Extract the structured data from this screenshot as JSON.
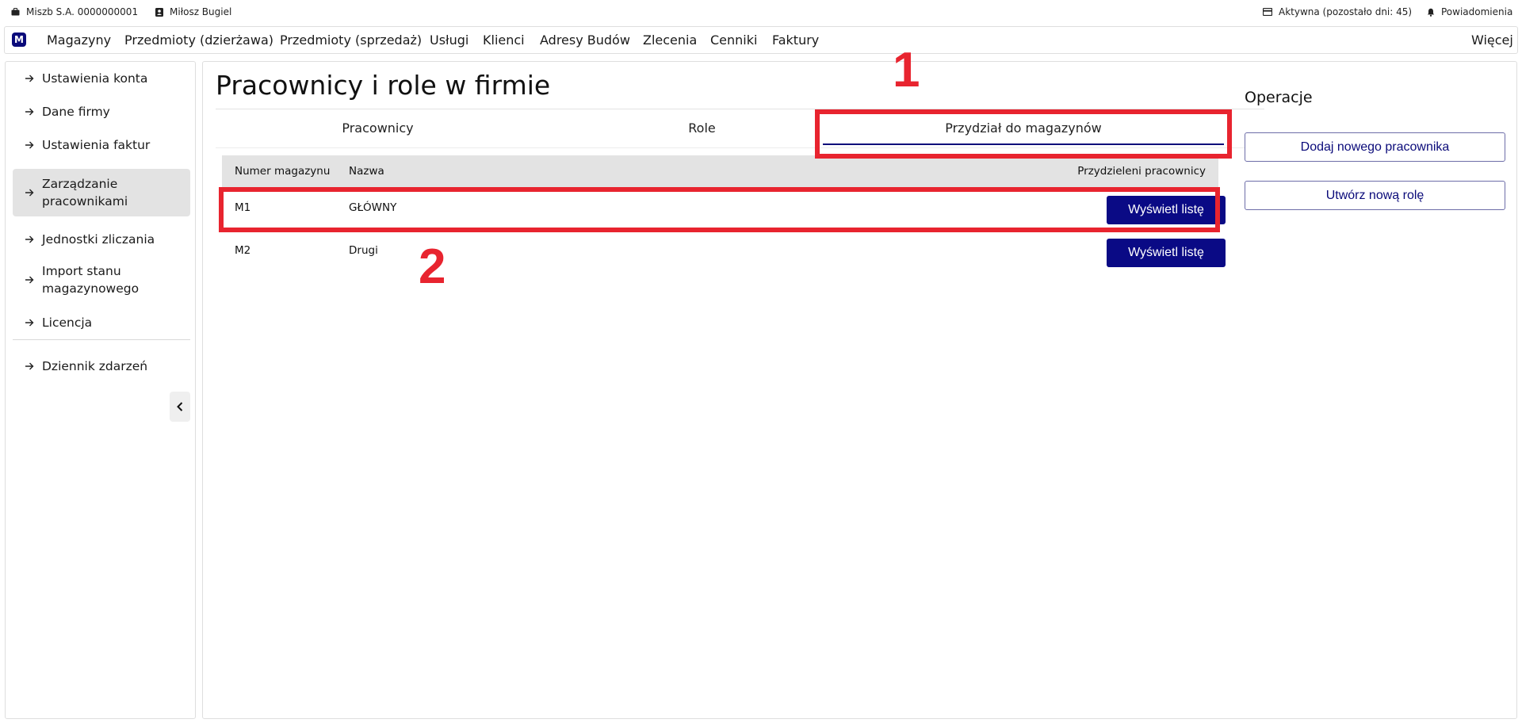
{
  "status_bar": {
    "company": "Miszb S.A. 0000000001",
    "user": "Miłosz Bugiel",
    "license": "Aktywna (pozostało dni: 45)",
    "notifications": "Powiadomienia"
  },
  "menu": {
    "logo": "M",
    "items": [
      "Magazyny",
      "Przedmioty (dzierżawa)",
      "Przedmioty (sprzedaż)",
      "Usługi",
      "Klienci",
      "Adresy Budów",
      "Zlecenia",
      "Cenniki",
      "Faktury"
    ],
    "more": "Więcej"
  },
  "sidebar": {
    "items": [
      {
        "label": "Ustawienia konta"
      },
      {
        "label": "Dane firmy"
      },
      {
        "label": "Ustawienia faktur"
      },
      {
        "label": "Zarządzanie pracownikami",
        "active": true
      },
      {
        "label": "Jednostki zliczania"
      },
      {
        "label": "Import stanu magazynowego"
      },
      {
        "label": "Licencja"
      },
      {
        "label": "Dziennik zdarzeń"
      }
    ]
  },
  "main": {
    "title": "Pracownicy i role w firmie",
    "tabs": [
      {
        "label": "Pracownicy"
      },
      {
        "label": "Role"
      },
      {
        "label": "Przydział do magazynów",
        "active": true
      }
    ],
    "table": {
      "headers": [
        "Numer magazynu",
        "Nazwa",
        "Przydzieleni pracownicy"
      ],
      "rows": [
        {
          "number": "M1",
          "name": "GŁÓWNY",
          "action": "Wyświetl listę"
        },
        {
          "number": "M2",
          "name": "Drugi",
          "action": "Wyświetl listę"
        }
      ]
    }
  },
  "operations": {
    "title": "Operacje",
    "buttons": [
      "Dodaj nowego pracownika",
      "Utwórz nową rolę"
    ]
  },
  "annotations": {
    "labels": [
      "1",
      "2"
    ],
    "color": "#e8242f"
  },
  "colors": {
    "accent": "#0b0b7a",
    "button": "#0a0a85",
    "active_bg": "#e3e3e3"
  }
}
